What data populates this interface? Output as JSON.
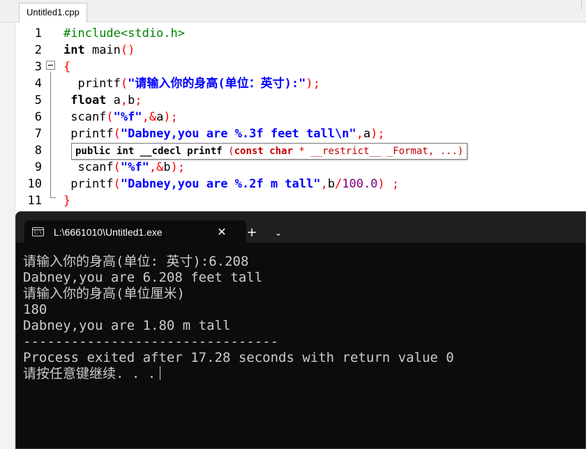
{
  "editor": {
    "file_tab": "Untitled1.cpp",
    "line_numbers": [
      "1",
      "2",
      "3",
      "4",
      "5",
      "6",
      "7",
      "8",
      "9",
      "10",
      "11"
    ],
    "lines": {
      "l1": "#include<stdio.h>",
      "l2_kw": "int",
      "l2_rest": " main",
      "l2_sym": "()",
      "l3": "{",
      "l4_a": "  printf",
      "l4_b": "(",
      "l4_str": "\"请输入你的身高(单位：英寸):\"",
      "l4_c": ");",
      "l5_kw": " float",
      "l5_rest": " a",
      "l5_s1": ",",
      "l5_b": "b",
      "l5_s2": ";",
      "l6_a": " scanf",
      "l6_b": "(",
      "l6_str": "\"%f\"",
      "l6_c": ",&",
      "l6_d": "a",
      "l6_e": ");",
      "l7_a": " printf",
      "l7_b": "(",
      "l7_str": "\"Dabney,you are %.3f feet tall\\n\"",
      "l7_c": ",",
      "l7_d": "a",
      "l7_e": ");",
      "l9_a": "  scanf",
      "l9_b": "(",
      "l9_str": "\"%f\"",
      "l9_c": ",&",
      "l9_d": "b",
      "l9_e": ");",
      "l10_a": " printf",
      "l10_b": "(",
      "l10_str": "\"Dabney,you are %.2f m tall\"",
      "l10_c": ",",
      "l10_d": "b",
      "l10_e": "/",
      "l10_num": "100.0",
      "l10_f": ") ;",
      "l11": "}"
    },
    "tooltip": {
      "prefix": "public int __cdecl printf ",
      "paren_open": "(",
      "kw_const": "const char",
      "star": " * ",
      "restrict": "__restrict__ _Format",
      "rest": ", ...",
      "paren_close": ")"
    }
  },
  "terminal": {
    "tab_title": "L:\\6661010\\Untitled1.exe",
    "tab_icon_text": "C:\\",
    "close_glyph": "✕",
    "new_tab_glyph": "+",
    "dropdown_glyph": "⌄",
    "output": [
      "请输入你的身高(单位: 英寸):6.208",
      "Dabney,you are 6.208 feet tall",
      "请输入你的身高(单位厘米)",
      "180",
      "Dabney,you are 1.80 m tall",
      "--------------------------------",
      "Process exited after 17.28 seconds with return value 0",
      "请按任意键继续. . ."
    ]
  }
}
